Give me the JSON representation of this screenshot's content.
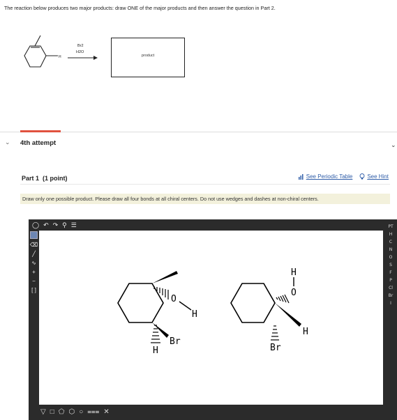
{
  "question": {
    "text": "The reaction below produces two major products: draw ONE of the major products and then answer the question in Part 2."
  },
  "reaction": {
    "reagent_top": "Br2",
    "reagent_bottom": "H2O",
    "h_label": "H",
    "product_label": "product"
  },
  "attempt": {
    "label": "4th attempt",
    "accent_color": "#e0523f"
  },
  "part": {
    "title": "Part 1",
    "points": "(1 point)",
    "periodic_table_link": "See Periodic Table",
    "hint_link": "See Hint",
    "instruction": "Draw only one possible product. Please draw all four bonds at all chiral centers. Do not use wedges and dashes at non-chiral centers."
  },
  "editor": {
    "top_tools": [
      "undo-icon",
      "redo-icon",
      "rotate-icon",
      "zoom-icon",
      "template-icon"
    ],
    "left_tools": [
      "select-tool-icon",
      "eraser-icon",
      "bond-icon",
      "chain-icon",
      "charge-plus-icon",
      "charge-minus-icon",
      "bracket-icon",
      "rgroup-icon"
    ],
    "bottom_tools": [
      "cyclopropane-icon",
      "cyclobutane-icon",
      "cyclopentane-icon",
      "cyclohexane-icon",
      "benzene-icon",
      "bond-angle-icon",
      "stereo-icon"
    ],
    "elements": [
      "H",
      "C",
      "N",
      "O",
      "S",
      "F",
      "P",
      "Cl",
      "Br",
      "I"
    ],
    "periodic_label": "PT",
    "molecule1": {
      "atom_o": "O",
      "atom_h_oh": "H",
      "atom_br": "Br",
      "atom_h": "H"
    },
    "molecule2": {
      "atom_h_top": "H",
      "atom_o": "O",
      "atom_h": "H",
      "atom_br": "Br"
    }
  }
}
